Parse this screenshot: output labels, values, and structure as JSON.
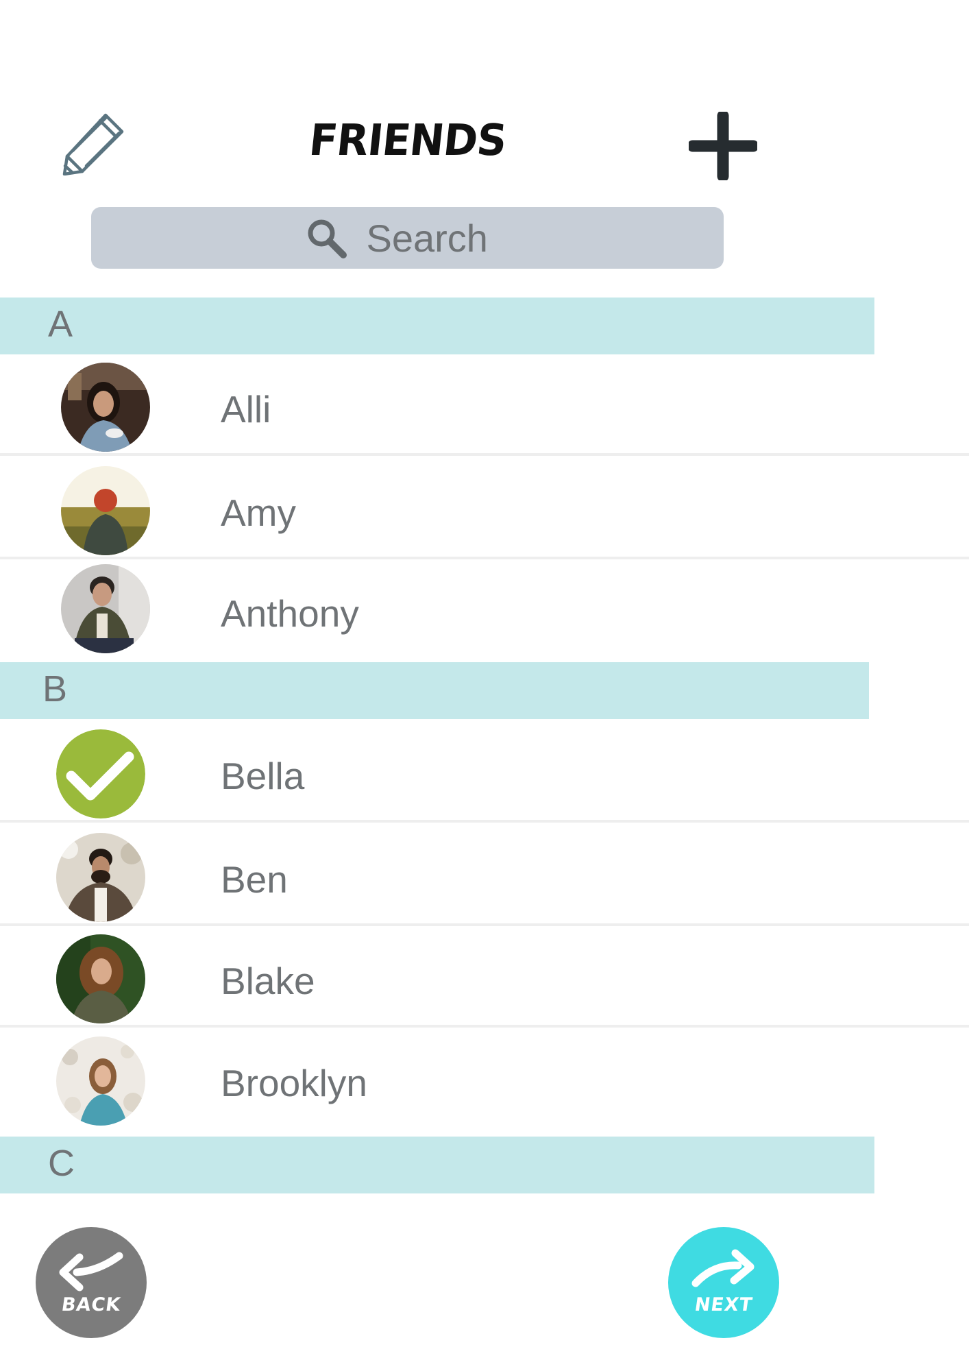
{
  "header": {
    "title": "FRIENDS",
    "edit_icon": "pencil-icon",
    "add_icon": "plus-icon"
  },
  "search": {
    "placeholder": "Search",
    "icon": "search-icon"
  },
  "sections": [
    {
      "letter": "A",
      "friends": [
        {
          "name": "Alli",
          "selected": false
        },
        {
          "name": "Amy",
          "selected": false
        },
        {
          "name": "Anthony",
          "selected": false
        }
      ]
    },
    {
      "letter": "B",
      "friends": [
        {
          "name": "Bella",
          "selected": true
        },
        {
          "name": "Ben",
          "selected": false
        },
        {
          "name": "Blake",
          "selected": false
        },
        {
          "name": "Brooklyn",
          "selected": false
        }
      ]
    },
    {
      "letter": "C",
      "friends": []
    }
  ],
  "footer": {
    "back_label": "BACK",
    "next_label": "NEXT"
  },
  "colors": {
    "section_band": "#c4e8ea",
    "search_bg": "#c7ced7",
    "text_gray": "#6f7376",
    "selected_green": "#9aba3b",
    "back_button": "#7c7c7c",
    "next_button": "#3fdbe2"
  }
}
